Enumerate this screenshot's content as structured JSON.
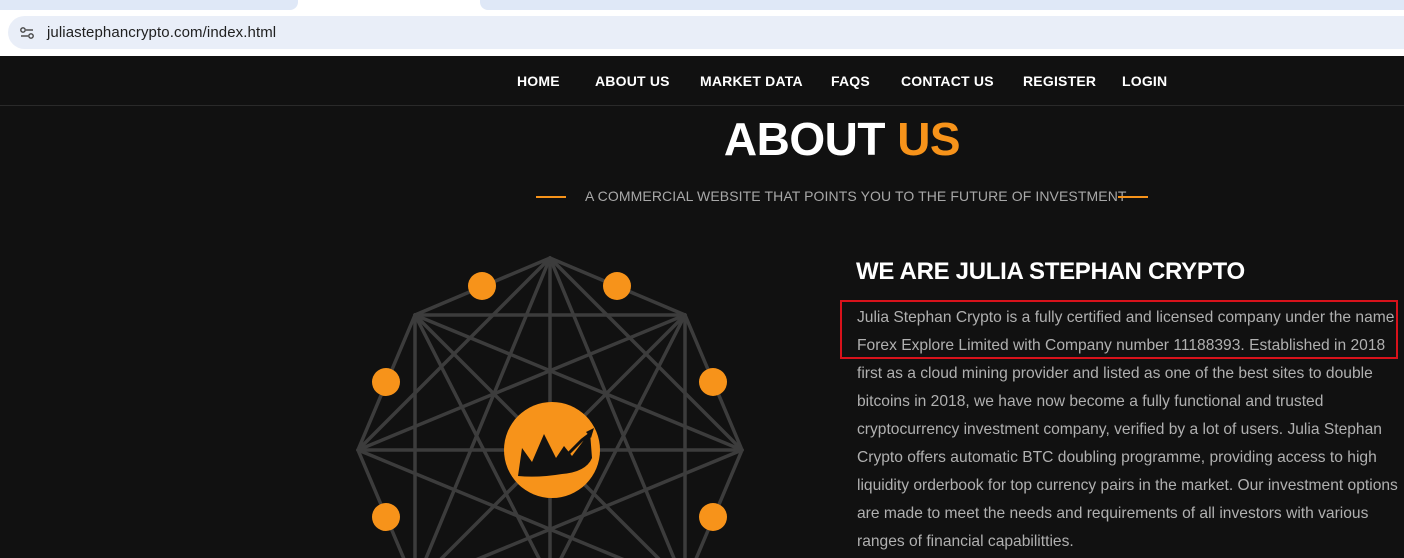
{
  "browser": {
    "url": "juliastephancrypto.com/index.html",
    "site_info_icon": "site-settings-icon"
  },
  "nav": {
    "items": [
      {
        "label": "HOME"
      },
      {
        "label": "ABOUT US"
      },
      {
        "label": "MARKET DATA"
      },
      {
        "label": "FAQS"
      },
      {
        "label": "CONTACT US"
      },
      {
        "label": "REGISTER"
      },
      {
        "label": "LOGIN"
      }
    ]
  },
  "about": {
    "title_main": "ABOUT",
    "title_accent": "US",
    "subtitle": "A COMMERCIAL WEBSITE THAT POINTS YOU TO THE FUTURE OF INVESTMENT"
  },
  "content": {
    "heading": "WE ARE JULIA STEPHAN CRYPTO",
    "paragraph": "Julia Stephan Crypto is a fully certified and licensed company under the name Forex Explore Limited with Company number 11188393. Established in 2018 first as a cloud mining provider and listed as one of the best sites to double bitcoins in 2018, we have now become a fully functional and trusted cryptocurrency investment company, verified by a lot of users. Julia Stephan Crypto offers automatic BTC doubling programme, providing access to high liquidity orderbook for top currency pairs in the market. Our investment options are made to meet the needs and requirements of all investors with various ranges of financial capabilitties."
  },
  "graphic": {
    "icon": "crypto-network-logo-icon",
    "center_icon": "chart-crown-icon"
  },
  "colors": {
    "accent": "#f7931a",
    "background": "#111111",
    "highlight_border": "#d8121b"
  }
}
